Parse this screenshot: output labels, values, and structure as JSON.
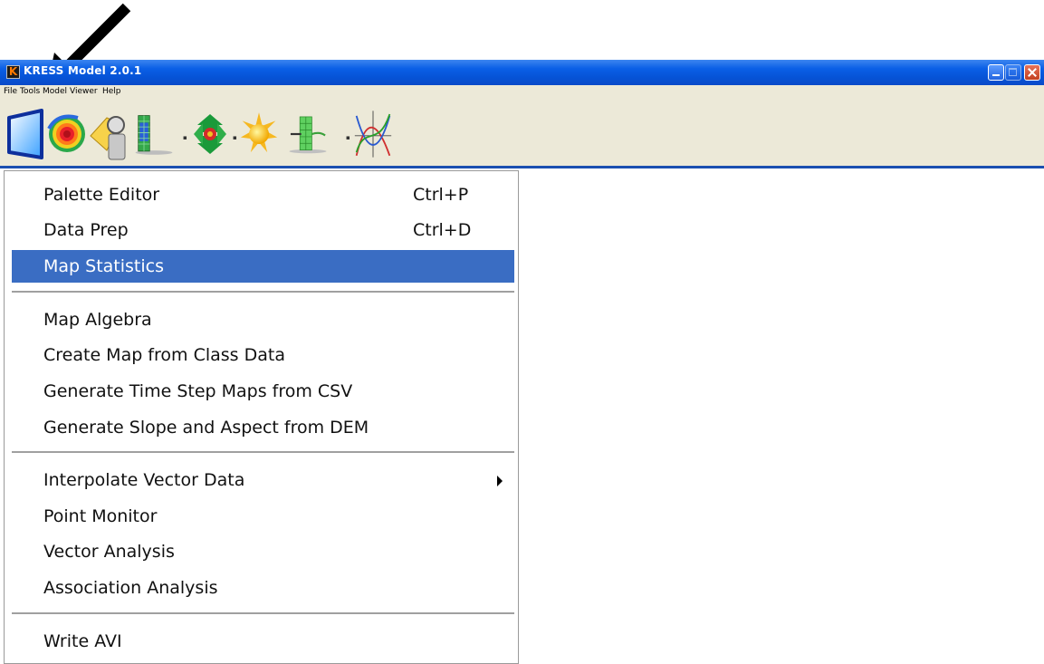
{
  "window": {
    "title": "KRESS Model 2.0.1",
    "app_icon": "kress-logo-icon",
    "controls": [
      "minimize-icon",
      "maximize-icon",
      "close-icon"
    ]
  },
  "menubar": {
    "items": [
      {
        "label": "File"
      },
      {
        "label": "Tools"
      },
      {
        "label": "Model"
      },
      {
        "label": "Viewer"
      },
      {
        "label": "Help"
      }
    ]
  },
  "toolbar": {
    "buttons": [
      {
        "icon": "blue-panel-icon"
      },
      {
        "icon": "color-swirl-icon"
      },
      {
        "icon": "map-magnifier-icon"
      },
      {
        "icon": "grid-layer-icon"
      },
      {
        "icon": "colorful-diamond-arrows-icon"
      },
      {
        "icon": "sun-icon"
      },
      {
        "icon": "green-grid-arrow-icon"
      },
      {
        "icon": "curve-graph-icon"
      }
    ]
  },
  "tools_menu": {
    "items": [
      {
        "label": "Palette Editor",
        "shortcut": "Ctrl+P"
      },
      {
        "label": "Data Prep",
        "shortcut": "Ctrl+D"
      },
      {
        "label": "Map Statistics",
        "shortcut": "",
        "selected": true
      },
      {
        "label": "Map Algebra",
        "shortcut": ""
      },
      {
        "label": "Create Map from Class Data",
        "shortcut": ""
      },
      {
        "label": "Generate Time Step Maps from CSV",
        "shortcut": ""
      },
      {
        "label": "Generate Slope and Aspect from DEM",
        "shortcut": ""
      },
      {
        "label": "Interpolate Vector Data",
        "shortcut": "",
        "submenu": true
      },
      {
        "label": "Point Monitor",
        "shortcut": ""
      },
      {
        "label": "Vector Analysis",
        "shortcut": ""
      },
      {
        "label": "Association Analysis",
        "shortcut": ""
      },
      {
        "label": "Write AVI",
        "shortcut": ""
      }
    ]
  },
  "colors": {
    "title_bar": "#0653d6",
    "selection": "#3a6dc3",
    "menubar_bg": "#ece9d8"
  }
}
